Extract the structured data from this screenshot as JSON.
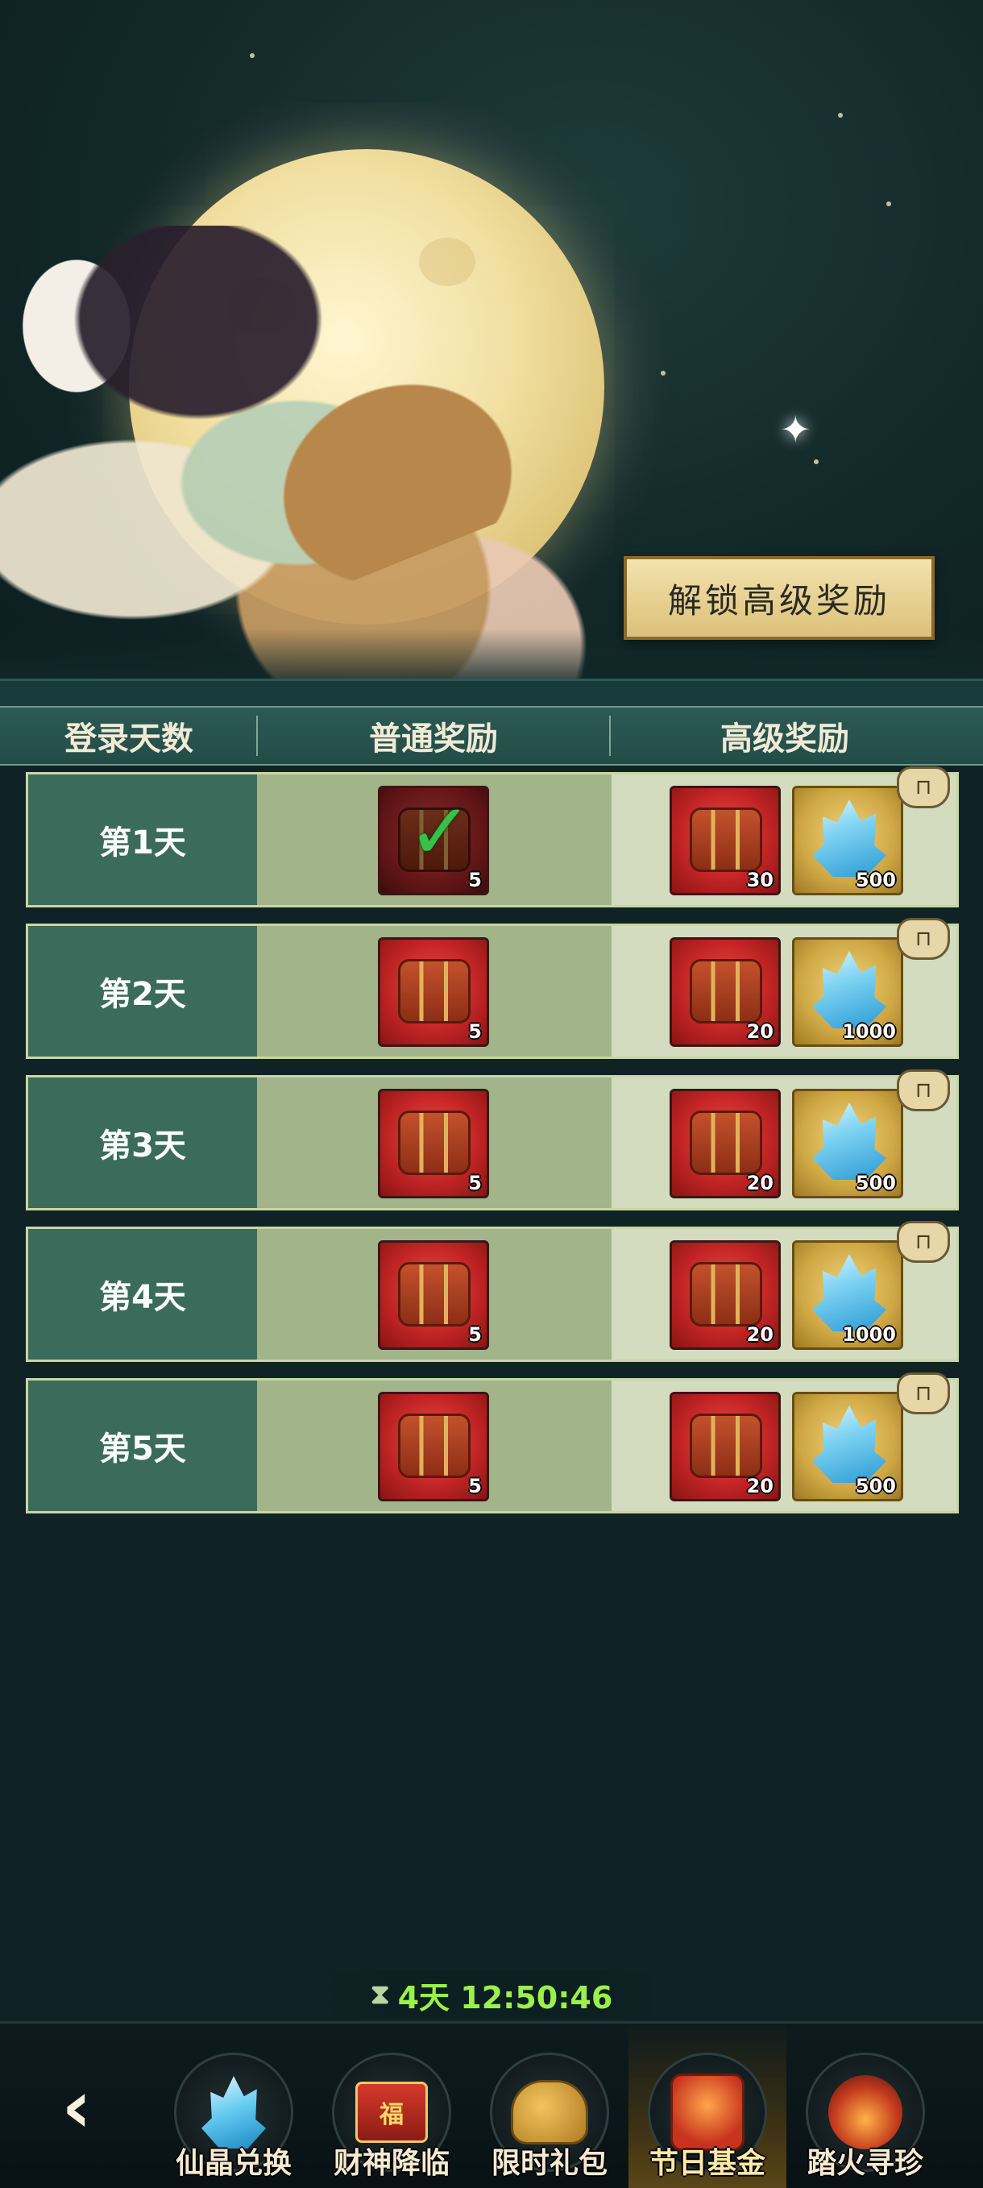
{
  "banner": {
    "unlock_button": "解锁高级奖励"
  },
  "table": {
    "headers": {
      "day": "登录天数",
      "normal": "普通奖励",
      "premium": "高级奖励"
    },
    "rows": [
      {
        "day": "第1天",
        "normal_qty": "5",
        "normal_claimed": true,
        "premium_chest_qty": "30",
        "premium_crystal_qty": "500"
      },
      {
        "day": "第2天",
        "normal_qty": "5",
        "normal_claimed": false,
        "premium_chest_qty": "20",
        "premium_crystal_qty": "1000"
      },
      {
        "day": "第3天",
        "normal_qty": "5",
        "normal_claimed": false,
        "premium_chest_qty": "20",
        "premium_crystal_qty": "500"
      },
      {
        "day": "第4天",
        "normal_qty": "5",
        "normal_claimed": false,
        "premium_chest_qty": "20",
        "premium_crystal_qty": "1000"
      },
      {
        "day": "第5天",
        "normal_qty": "5",
        "normal_claimed": false,
        "premium_chest_qty": "20",
        "premium_crystal_qty": "500"
      }
    ]
  },
  "timer": {
    "text": "4天 12:50:46"
  },
  "nav": {
    "back_icon": "back-arrow-icon",
    "tabs": [
      {
        "label": "仙晶兑换",
        "icon": "crystal-icon",
        "active": false
      },
      {
        "label": "财神降临",
        "icon": "gift-box-icon",
        "active": false
      },
      {
        "label": "限时礼包",
        "icon": "money-bag-icon",
        "active": false
      },
      {
        "label": "节日基金",
        "icon": "fund-icon",
        "active": true
      },
      {
        "label": "踏火寻珍",
        "icon": "fire-treasure-icon",
        "active": false
      }
    ]
  }
}
